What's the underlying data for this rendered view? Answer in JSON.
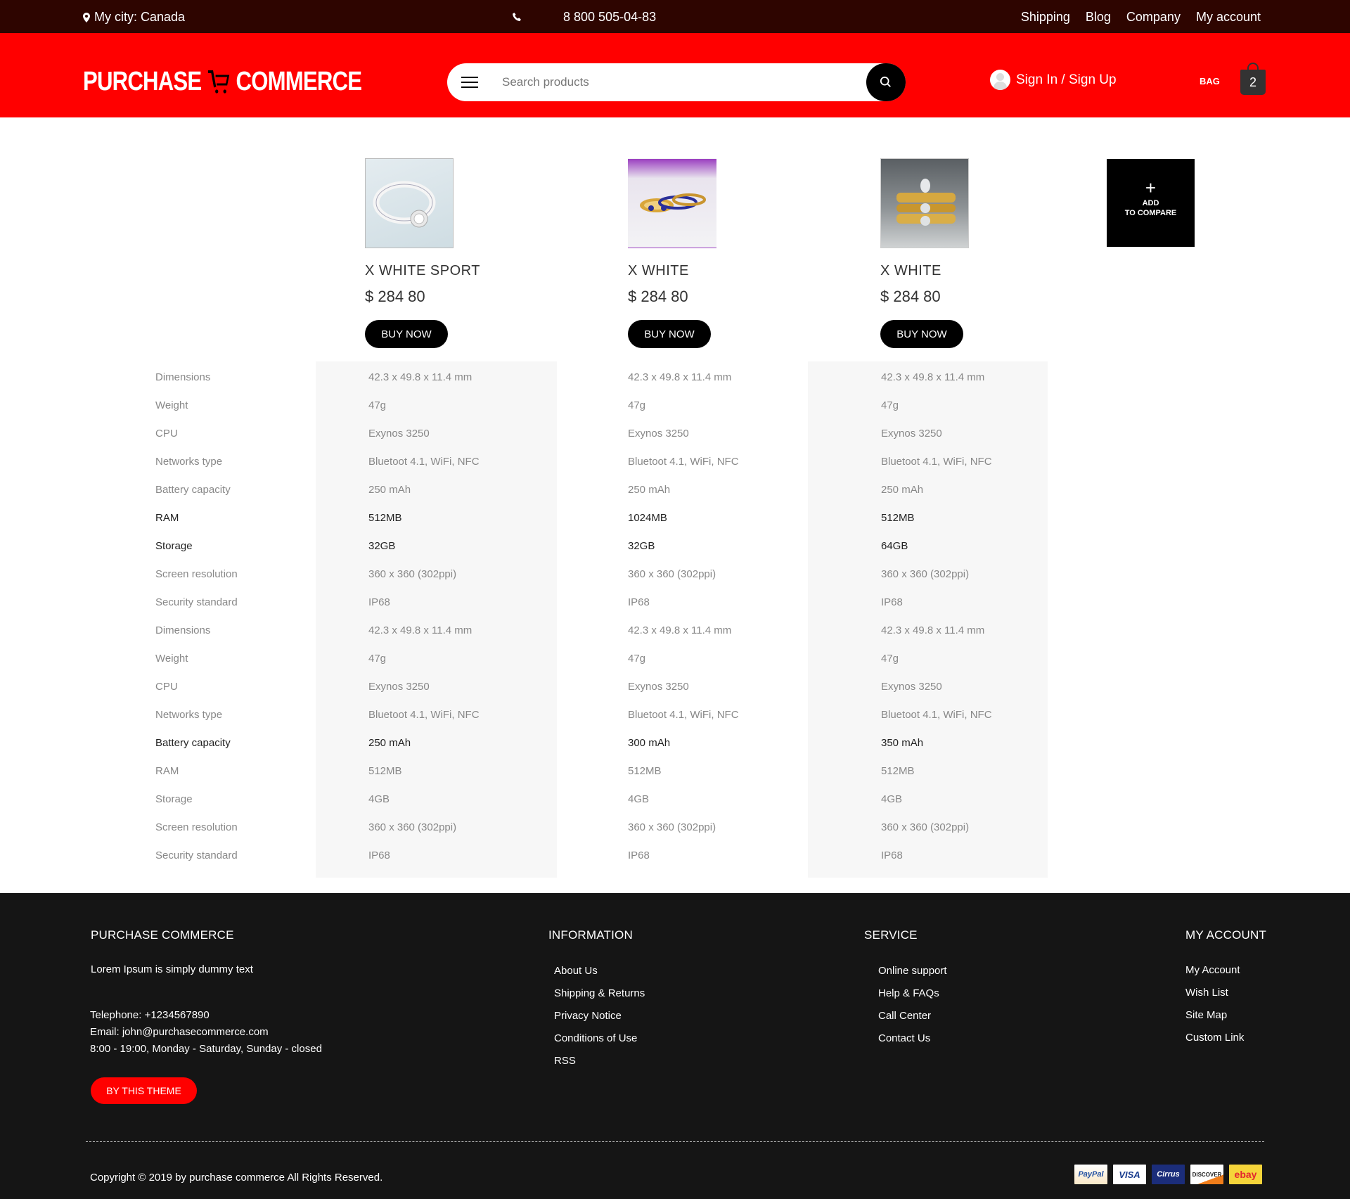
{
  "topbar": {
    "city": "My city: Canada",
    "phone": "8 800 505-04-83",
    "links": [
      "Shipping",
      "Blog",
      "Company",
      "My account"
    ]
  },
  "header": {
    "logo_left": "PURCHASE",
    "logo_right": "COMMERCE",
    "search_placeholder": "Search products",
    "signin": "Sign In / Sign Up",
    "bag_label": "BAG",
    "bag_count": "2",
    "brand_color": "#ff0000",
    "topbar_color": "#2e0500"
  },
  "products": [
    {
      "name": "X WHITE SPORT",
      "price": "$ 284 80",
      "buy": "BUY NOW",
      "image": "silver-ring"
    },
    {
      "name": "X WHITE",
      "price": "$ 284 80",
      "buy": "BUY NOW",
      "image": "gold-sapphire-rings"
    },
    {
      "name": "X WHITE",
      "price": "$ 284 80",
      "buy": "BUY NOW",
      "image": "gold-diamond-rings"
    }
  ],
  "add_compare": {
    "line1": "ADD",
    "line2": "TO COMPARE"
  },
  "specs": [
    {
      "label": "Dimensions",
      "values": [
        "42.3 x 49.8 x 11.4 mm",
        "42.3 x 49.8 x 11.4 mm",
        "42.3 x 49.8 x 11.4 mm"
      ],
      "highlight": false
    },
    {
      "label": "Weight",
      "values": [
        "47g",
        "47g",
        "47g"
      ],
      "highlight": false
    },
    {
      "label": "CPU",
      "values": [
        "Exynos 3250",
        "Exynos 3250",
        "Exynos 3250"
      ],
      "highlight": false
    },
    {
      "label": "Networks type",
      "values": [
        "Bluetoot 4.1, WiFi, NFC",
        "Bluetoot 4.1, WiFi, NFC",
        "Bluetoot 4.1, WiFi, NFC"
      ],
      "highlight": false
    },
    {
      "label": "Battery capacity",
      "values": [
        "250 mAh",
        "250 mAh",
        "250 mAh"
      ],
      "highlight": false
    },
    {
      "label": "RAM",
      "values": [
        "512MB",
        "1024MB",
        "512MB"
      ],
      "highlight": true
    },
    {
      "label": "Storage",
      "values": [
        "32GB",
        "32GB",
        "64GB"
      ],
      "highlight": true
    },
    {
      "label": "Screen resolution",
      "values": [
        "360 x 360 (302ppi)",
        "360 x 360 (302ppi)",
        "360 x 360 (302ppi)"
      ],
      "highlight": false
    },
    {
      "label": "Security standard",
      "values": [
        "IP68",
        "IP68",
        "IP68"
      ],
      "highlight": false
    },
    {
      "label": "Dimensions",
      "values": [
        "42.3 x 49.8 x 11.4 mm",
        "42.3 x 49.8 x 11.4 mm",
        "42.3 x 49.8 x 11.4 mm"
      ],
      "highlight": false
    },
    {
      "label": "Weight",
      "values": [
        "47g",
        "47g",
        "47g"
      ],
      "highlight": false
    },
    {
      "label": "CPU",
      "values": [
        "Exynos 3250",
        "Exynos 3250",
        "Exynos 3250"
      ],
      "highlight": false
    },
    {
      "label": "Networks type",
      "values": [
        "Bluetoot 4.1, WiFi, NFC",
        "Bluetoot 4.1, WiFi, NFC",
        "Bluetoot 4.1, WiFi, NFC"
      ],
      "highlight": false
    },
    {
      "label": "Battery capacity",
      "values": [
        "250 mAh",
        "300 mAh",
        "350 mAh"
      ],
      "highlight": true
    },
    {
      "label": "RAM",
      "values": [
        "512MB",
        "512MB",
        "512MB"
      ],
      "highlight": false
    },
    {
      "label": "Storage",
      "values": [
        "4GB",
        "4GB",
        "4GB"
      ],
      "highlight": false
    },
    {
      "label": "Screen resolution",
      "values": [
        "360 x 360 (302ppi)",
        "360 x 360 (302ppi)",
        "360 x 360 (302ppi)"
      ],
      "highlight": false
    },
    {
      "label": "Security standard",
      "values": [
        "IP68",
        "IP68",
        "IP68"
      ],
      "highlight": false
    }
  ],
  "footer": {
    "brand_title": "PURCHASE COMMERCE",
    "about": "Lorem Ipsum is simply dummy text",
    "telephone": "Telephone: +1234567890",
    "email": "Email: john@purchasecommerce.com",
    "hours": "8:00 - 19:00, Monday - Saturday, Sunday - closed",
    "theme_button": "BY THIS THEME",
    "information_title": "INFORMATION",
    "information_links": [
      "About Us",
      "Shipping & Returns",
      "Privacy Notice",
      "Conditions of Use",
      "RSS"
    ],
    "service_title": "SERVICE",
    "service_links": [
      "Online support",
      "Help & FAQs",
      "Call Center",
      "Contact Us"
    ],
    "account_title": "MY ACCOUNT",
    "account_links": [
      "My Account",
      "Wish List",
      "Site Map",
      "Custom Link"
    ],
    "copyright": "Copyright © 2019 by purchase commerce All Rights Reserved.",
    "payment_cards": [
      "PayPal",
      "VISA",
      "Cirrus",
      "DISCOVER",
      "ebay"
    ]
  }
}
